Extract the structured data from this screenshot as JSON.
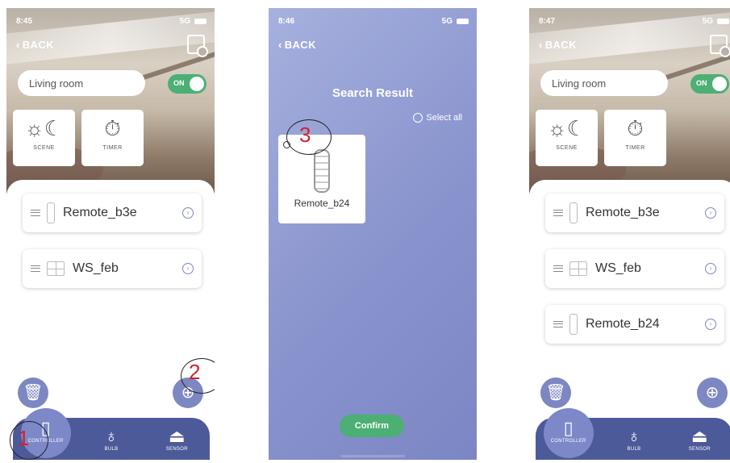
{
  "screen1": {
    "time": "8:45",
    "signal": "5G",
    "back": "BACK",
    "room": "Living room",
    "toggle": "ON",
    "tiles": [
      {
        "label": "SCENE",
        "icon": "☼☾"
      },
      {
        "label": "TIMER",
        "icon": "⏱"
      }
    ],
    "items": [
      {
        "name": "Remote_b3e"
      },
      {
        "name": "WS_feb"
      }
    ],
    "nav": [
      "CONTROLLER",
      "BULB",
      "SENSOR"
    ],
    "annotations": [
      "1",
      "2"
    ]
  },
  "screen2": {
    "time": "8:46",
    "signal": "5G",
    "back": "BACK",
    "title": "Search Result",
    "select_all": "Select all",
    "result": "Remote_b24",
    "confirm": "Confirm",
    "annotation": "3"
  },
  "screen3": {
    "time": "8:47",
    "signal": "5G",
    "back": "BACK",
    "room": "Living room",
    "toggle": "ON",
    "tiles": [
      {
        "label": "SCENE",
        "icon": "☼☾"
      },
      {
        "label": "TIMER",
        "icon": "⏱"
      }
    ],
    "items": [
      {
        "name": "Remote_b3e"
      },
      {
        "name": "WS_feb"
      },
      {
        "name": "Remote_b24"
      }
    ],
    "nav": [
      "CONTROLLER",
      "BULB",
      "SENSOR"
    ]
  },
  "colors": {
    "accent": "#7d87c2",
    "nav": "#4d5a99",
    "green": "#4caf74",
    "annotation": "#d0232a"
  }
}
